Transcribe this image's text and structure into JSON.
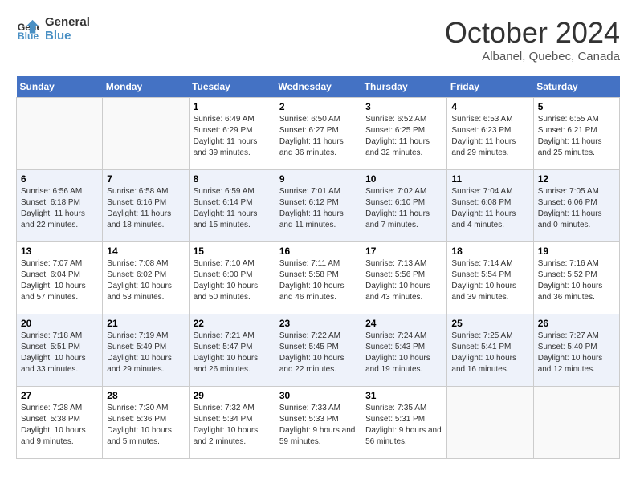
{
  "header": {
    "logo_line1": "General",
    "logo_line2": "Blue",
    "month": "October 2024",
    "location": "Albanel, Quebec, Canada"
  },
  "weekdays": [
    "Sunday",
    "Monday",
    "Tuesday",
    "Wednesday",
    "Thursday",
    "Friday",
    "Saturday"
  ],
  "weeks": [
    [
      {
        "day": "",
        "info": ""
      },
      {
        "day": "",
        "info": ""
      },
      {
        "day": "1",
        "info": "Sunrise: 6:49 AM\nSunset: 6:29 PM\nDaylight: 11 hours and 39 minutes."
      },
      {
        "day": "2",
        "info": "Sunrise: 6:50 AM\nSunset: 6:27 PM\nDaylight: 11 hours and 36 minutes."
      },
      {
        "day": "3",
        "info": "Sunrise: 6:52 AM\nSunset: 6:25 PM\nDaylight: 11 hours and 32 minutes."
      },
      {
        "day": "4",
        "info": "Sunrise: 6:53 AM\nSunset: 6:23 PM\nDaylight: 11 hours and 29 minutes."
      },
      {
        "day": "5",
        "info": "Sunrise: 6:55 AM\nSunset: 6:21 PM\nDaylight: 11 hours and 25 minutes."
      }
    ],
    [
      {
        "day": "6",
        "info": "Sunrise: 6:56 AM\nSunset: 6:18 PM\nDaylight: 11 hours and 22 minutes."
      },
      {
        "day": "7",
        "info": "Sunrise: 6:58 AM\nSunset: 6:16 PM\nDaylight: 11 hours and 18 minutes."
      },
      {
        "day": "8",
        "info": "Sunrise: 6:59 AM\nSunset: 6:14 PM\nDaylight: 11 hours and 15 minutes."
      },
      {
        "day": "9",
        "info": "Sunrise: 7:01 AM\nSunset: 6:12 PM\nDaylight: 11 hours and 11 minutes."
      },
      {
        "day": "10",
        "info": "Sunrise: 7:02 AM\nSunset: 6:10 PM\nDaylight: 11 hours and 7 minutes."
      },
      {
        "day": "11",
        "info": "Sunrise: 7:04 AM\nSunset: 6:08 PM\nDaylight: 11 hours and 4 minutes."
      },
      {
        "day": "12",
        "info": "Sunrise: 7:05 AM\nSunset: 6:06 PM\nDaylight: 11 hours and 0 minutes."
      }
    ],
    [
      {
        "day": "13",
        "info": "Sunrise: 7:07 AM\nSunset: 6:04 PM\nDaylight: 10 hours and 57 minutes."
      },
      {
        "day": "14",
        "info": "Sunrise: 7:08 AM\nSunset: 6:02 PM\nDaylight: 10 hours and 53 minutes."
      },
      {
        "day": "15",
        "info": "Sunrise: 7:10 AM\nSunset: 6:00 PM\nDaylight: 10 hours and 50 minutes."
      },
      {
        "day": "16",
        "info": "Sunrise: 7:11 AM\nSunset: 5:58 PM\nDaylight: 10 hours and 46 minutes."
      },
      {
        "day": "17",
        "info": "Sunrise: 7:13 AM\nSunset: 5:56 PM\nDaylight: 10 hours and 43 minutes."
      },
      {
        "day": "18",
        "info": "Sunrise: 7:14 AM\nSunset: 5:54 PM\nDaylight: 10 hours and 39 minutes."
      },
      {
        "day": "19",
        "info": "Sunrise: 7:16 AM\nSunset: 5:52 PM\nDaylight: 10 hours and 36 minutes."
      }
    ],
    [
      {
        "day": "20",
        "info": "Sunrise: 7:18 AM\nSunset: 5:51 PM\nDaylight: 10 hours and 33 minutes."
      },
      {
        "day": "21",
        "info": "Sunrise: 7:19 AM\nSunset: 5:49 PM\nDaylight: 10 hours and 29 minutes."
      },
      {
        "day": "22",
        "info": "Sunrise: 7:21 AM\nSunset: 5:47 PM\nDaylight: 10 hours and 26 minutes."
      },
      {
        "day": "23",
        "info": "Sunrise: 7:22 AM\nSunset: 5:45 PM\nDaylight: 10 hours and 22 minutes."
      },
      {
        "day": "24",
        "info": "Sunrise: 7:24 AM\nSunset: 5:43 PM\nDaylight: 10 hours and 19 minutes."
      },
      {
        "day": "25",
        "info": "Sunrise: 7:25 AM\nSunset: 5:41 PM\nDaylight: 10 hours and 16 minutes."
      },
      {
        "day": "26",
        "info": "Sunrise: 7:27 AM\nSunset: 5:40 PM\nDaylight: 10 hours and 12 minutes."
      }
    ],
    [
      {
        "day": "27",
        "info": "Sunrise: 7:28 AM\nSunset: 5:38 PM\nDaylight: 10 hours and 9 minutes."
      },
      {
        "day": "28",
        "info": "Sunrise: 7:30 AM\nSunset: 5:36 PM\nDaylight: 10 hours and 5 minutes."
      },
      {
        "day": "29",
        "info": "Sunrise: 7:32 AM\nSunset: 5:34 PM\nDaylight: 10 hours and 2 minutes."
      },
      {
        "day": "30",
        "info": "Sunrise: 7:33 AM\nSunset: 5:33 PM\nDaylight: 9 hours and 59 minutes."
      },
      {
        "day": "31",
        "info": "Sunrise: 7:35 AM\nSunset: 5:31 PM\nDaylight: 9 hours and 56 minutes."
      },
      {
        "day": "",
        "info": ""
      },
      {
        "day": "",
        "info": ""
      }
    ]
  ]
}
